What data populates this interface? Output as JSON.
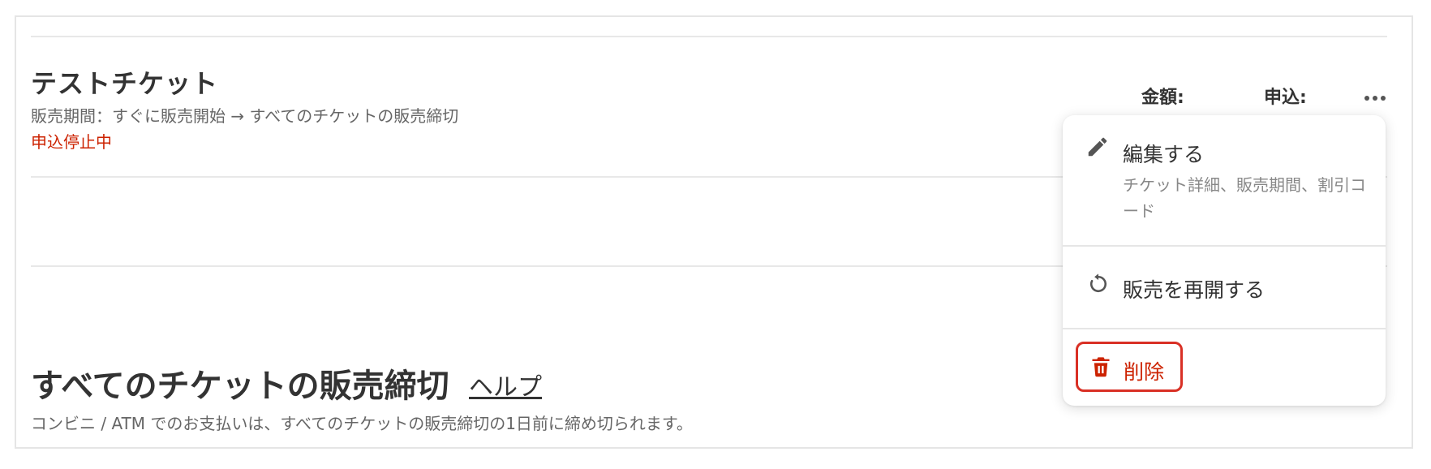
{
  "ticket": {
    "name": "テストチケット",
    "period": "販売期間：すぐに販売開始 → すべてのチケットの販売締切",
    "status": "申込停止中",
    "amount_label": "金額:",
    "apply_label": "申込:",
    "more_icon": "more-horizontal-icon"
  },
  "section": {
    "title": "すべてのチケットの販売締切",
    "help_link": "ヘルプ",
    "note": "コンビニ / ATM でのお支払いは、すべてのチケットの販売締切の1日前に締め切られます。"
  },
  "menu": {
    "edit": {
      "label": "編集する",
      "description": "チケット詳細、販売期間、割引コード",
      "icon": "pencil-icon"
    },
    "resume": {
      "label": "販売を再開する",
      "icon": "refresh-icon"
    },
    "delete": {
      "label": "削除",
      "icon": "trash-icon"
    }
  },
  "colors": {
    "text": "#333333",
    "muted": "#666666",
    "danger": "#cc2200",
    "highlight": "#d93025"
  }
}
